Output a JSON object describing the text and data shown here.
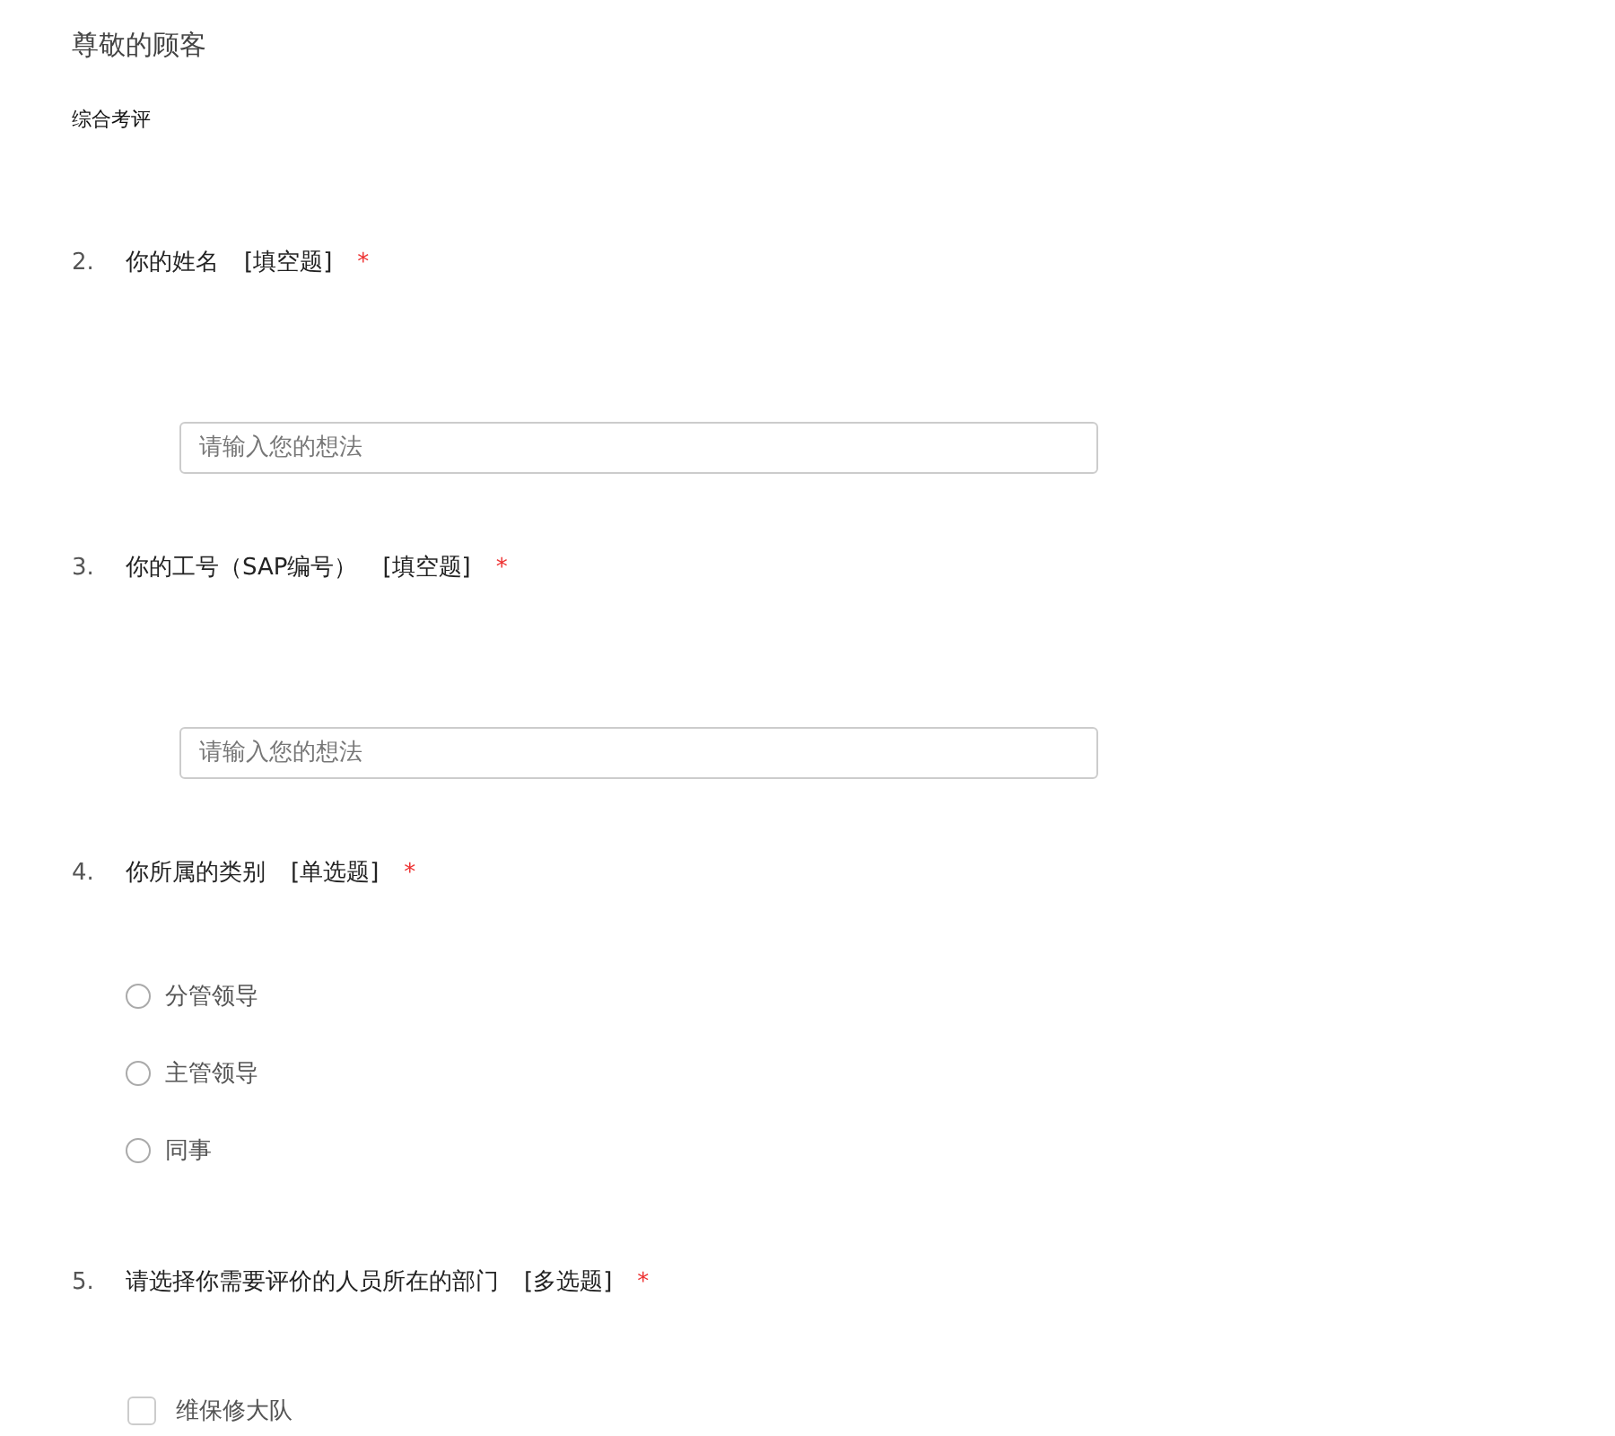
{
  "survey": {
    "title": "尊敬的顾客",
    "subtitle": "综合考评"
  },
  "questions": [
    {
      "number": "2.",
      "text": "你的姓名",
      "type_tag": "[填空题]",
      "required_mark": "*",
      "kind": "text",
      "placeholder": "请输入您的想法"
    },
    {
      "number": "3.",
      "text": "你的工号（SAP编号）",
      "type_tag": "[填空题]",
      "required_mark": "*",
      "kind": "text",
      "placeholder": "请输入您的想法"
    },
    {
      "number": "4.",
      "text": "你所属的类别",
      "type_tag": "[单选题]",
      "required_mark": "*",
      "kind": "radio",
      "options": [
        {
          "label": "分管领导",
          "selected": false
        },
        {
          "label": "主管领导",
          "selected": false
        },
        {
          "label": "同事",
          "selected": false
        }
      ]
    },
    {
      "number": "5.",
      "text": "请选择你需要评价的人员所在的部门",
      "type_tag": "[多选题]",
      "required_mark": "*",
      "kind": "checkbox",
      "options": [
        {
          "label": "维保修大队",
          "checked": false
        }
      ]
    }
  ]
}
